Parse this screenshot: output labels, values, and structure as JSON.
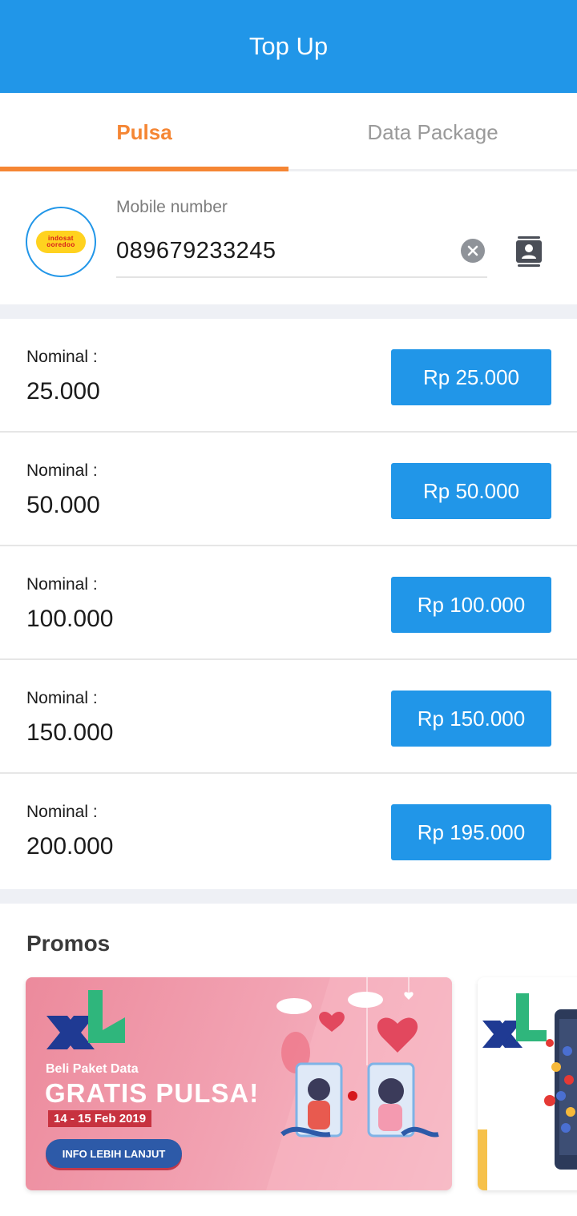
{
  "header": {
    "title": "Top Up"
  },
  "tabs": [
    {
      "label": "Pulsa",
      "active": true
    },
    {
      "label": "Data Package",
      "active": false
    }
  ],
  "number_form": {
    "operator_logo": {
      "line1": "indosat",
      "line2": "ooredoo"
    },
    "label": "Mobile number",
    "value": "089679233245"
  },
  "nominals": [
    {
      "label": "Nominal :",
      "value": "25.000",
      "price": "Rp 25.000"
    },
    {
      "label": "Nominal :",
      "value": "50.000",
      "price": "Rp 50.000"
    },
    {
      "label": "Nominal :",
      "value": "100.000",
      "price": "Rp 100.000"
    },
    {
      "label": "Nominal :",
      "value": "150.000",
      "price": "Rp 150.000"
    },
    {
      "label": "Nominal :",
      "value": "200.000",
      "price": "Rp 195.000"
    }
  ],
  "promos": {
    "title": "Promos",
    "cards": [
      {
        "subtitle": "Beli Paket Data",
        "headline": "GRATIS PULSA!",
        "date": "14 - 15 Feb 2019",
        "button": "INFO LEBIH LANJUT"
      }
    ]
  },
  "colors": {
    "primary": "#2196e8",
    "accent": "#f58634",
    "divider": "#eef0f5"
  }
}
